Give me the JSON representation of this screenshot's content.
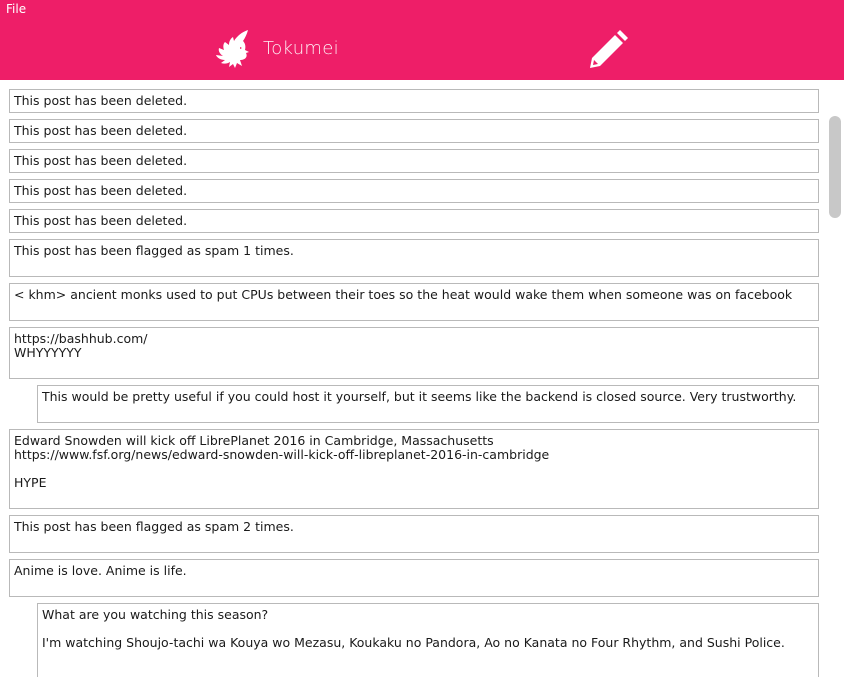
{
  "menu": {
    "file_label": "File"
  },
  "header": {
    "app_title": "Tokumei",
    "logo_icon": "eagle-icon",
    "compose_icon": "pencil-icon",
    "background_color": "#ee1e68"
  },
  "posts": [
    {
      "text": "This post has been deleted."
    },
    {
      "text": "This post has been deleted."
    },
    {
      "text": "This post has been deleted."
    },
    {
      "text": "This post has been deleted."
    },
    {
      "text": "This post has been deleted."
    },
    {
      "text": "This post has been flagged as spam 1 times."
    },
    {
      "text": "< khm> ancient monks used to put CPUs between their toes so the heat would wake them when someone was on facebook"
    },
    {
      "text": "https://bashhub.com/\nWHYYYYYY"
    },
    {
      "text": "This would be pretty useful if you could host it yourself, but it seems like the backend is closed source. Very trustworthy."
    },
    {
      "text": "Edward Snowden will kick off LibrePlanet 2016 in Cambridge, Massachusetts\nhttps://www.fsf.org/news/edward-snowden-will-kick-off-libreplanet-2016-in-cambridge\n\nHYPE"
    },
    {
      "text": "This post has been flagged as spam 2 times."
    },
    {
      "text": "Anime is love. Anime is life."
    },
    {
      "text": "What are you watching this season?\n\nI'm watching Shoujo-tachi wa Kouya wo Mezasu, Koukaku no Pandora, Ao no Kanata no Four Rhythm, and Sushi Police."
    }
  ]
}
